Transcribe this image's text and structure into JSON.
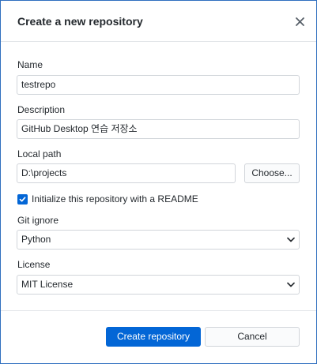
{
  "dialog": {
    "title": "Create a new repository",
    "close_icon": "close-icon"
  },
  "form": {
    "name_label": "Name",
    "name_value": "testrepo",
    "description_label": "Description",
    "description_value": "GitHub Desktop 연습 저장소",
    "local_path_label": "Local path",
    "local_path_value": "D:\\projects",
    "choose_label": "Choose...",
    "readme_checked": true,
    "readme_label": "Initialize this repository with a README",
    "gitignore_label": "Git ignore",
    "gitignore_value": "Python",
    "license_label": "License",
    "license_value": "MIT License"
  },
  "footer": {
    "create_label": "Create repository",
    "cancel_label": "Cancel"
  },
  "colors": {
    "accent": "#0366d6",
    "border": "#d1d5da"
  }
}
